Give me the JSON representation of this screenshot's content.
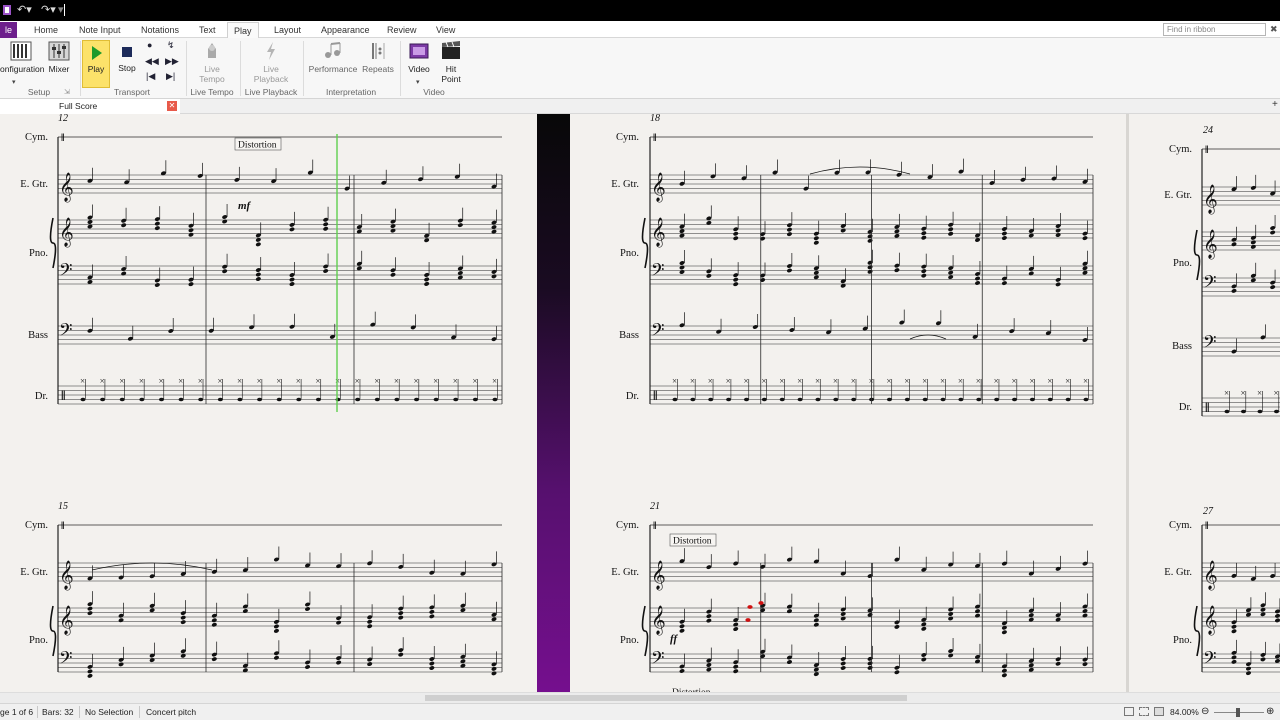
{
  "titlebar": {
    "undo_icon": "undo-icon",
    "redo_icon": "redo-icon"
  },
  "tabs": {
    "file": "le",
    "items": [
      "Home",
      "Note Input",
      "Notations",
      "Text",
      "Play",
      "Layout",
      "Appearance",
      "Review",
      "View"
    ],
    "active": "Play"
  },
  "search": {
    "placeholder": "Find in ribbon"
  },
  "ribbon": {
    "buttons": {
      "configuration": "onfiguration",
      "mixer": "Mixer",
      "play": "Play",
      "stop": "Stop",
      "live_tempo": "Live Tempo",
      "live_playback": "Live Playback",
      "performance": "Performance",
      "repeats": "Repeats",
      "video": "Video",
      "hit_point": "Hit Point"
    },
    "groups": {
      "setup": "Setup",
      "transport": "Transport",
      "live_tempo": "Live Tempo",
      "live_playback": "Live Playback",
      "interpretation": "Interpretation",
      "video": "Video"
    }
  },
  "document_tab": {
    "label": "Full Score"
  },
  "score": {
    "instruments": {
      "cymbal": "Cym.",
      "guitar": "E. Gtr.",
      "piano": "Pno.",
      "bass": "Bass",
      "drums": "Dr."
    },
    "measure_numbers": {
      "system1": "12",
      "system2": "15",
      "system3": "18",
      "system4": "21",
      "system5": "24",
      "system6": "27"
    },
    "text_marks": {
      "distortion": "Distortion"
    },
    "dynamics": {
      "mf": "mf",
      "ff": "ff"
    },
    "colors": {
      "playback_line": "#5fcf4f",
      "selected_note": "#d01010",
      "file_tab": "#6d1f8c"
    }
  },
  "status": {
    "page": "ge 1 of 6",
    "bars": "Bars: 32",
    "selection": "No Selection",
    "pitch": "Concert pitch",
    "zoom": "84.00%"
  }
}
